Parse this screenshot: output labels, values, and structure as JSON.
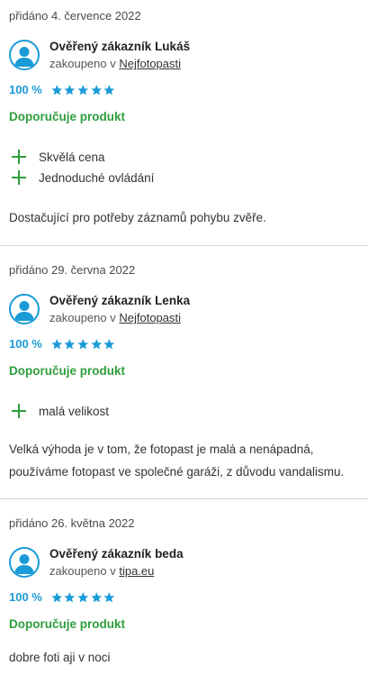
{
  "reviews": [
    {
      "date": "přidáno 4. července 2022",
      "author": "Ověřený zákazník Lukáš",
      "bought_prefix": "zakoupeno v",
      "shop": "Nejfotopasti",
      "percent": "100 %",
      "stars": 5,
      "recommend": "Doporučuje produkt",
      "pros": [
        "Skvělá cena",
        "Jednoduché ovládání"
      ],
      "comment": "Dostačující pro potřeby záznamů pohybu zvěře."
    },
    {
      "date": "přidáno 29. června 2022",
      "author": "Ověřený zákazník Lenka",
      "bought_prefix": "zakoupeno v",
      "shop": "Nejfotopasti",
      "percent": "100 %",
      "stars": 5,
      "recommend": "Doporučuje produkt",
      "pros": [
        "malá velikost"
      ],
      "comment_lines": [
        "Velká výhoda je v tom, že fotopast je malá a nenápadná,",
        "používáme fotopast ve společné garáži, z důvodu vandalismu."
      ]
    },
    {
      "date": "přidáno 26. května 2022",
      "author": "Ověřený zákazník beda",
      "bought_prefix": "zakoupeno v",
      "shop": "tipa.eu",
      "percent": "100 %",
      "stars": 5,
      "recommend": "Doporučuje produkt",
      "comment": "dobre foti aji v noci"
    }
  ],
  "colors": {
    "accent": "#1a9bd7",
    "green": "#2e9e3c",
    "divider": "#d6d6d6"
  }
}
